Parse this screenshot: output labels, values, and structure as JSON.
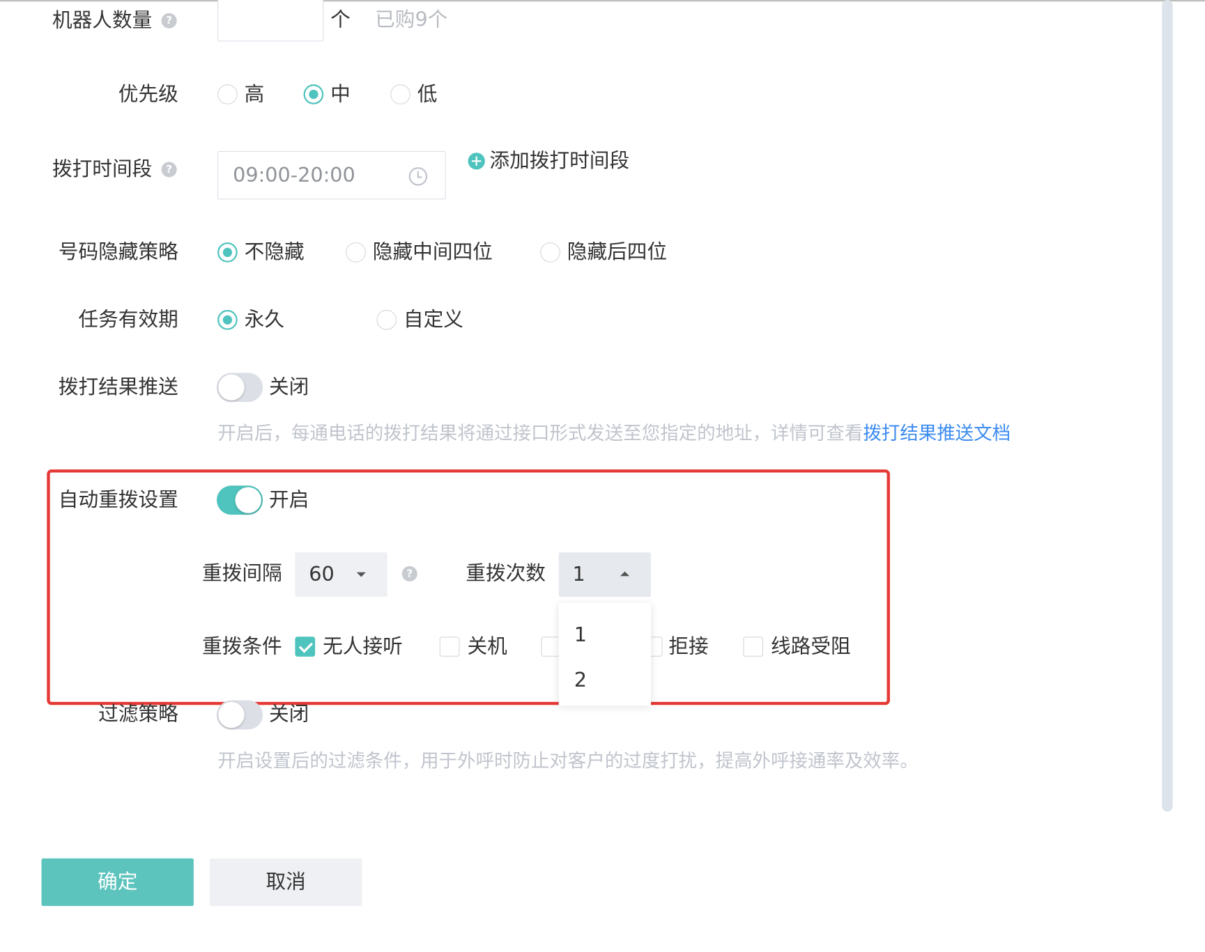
{
  "form": {
    "robot_count": {
      "label": "机器人数量",
      "help": "?",
      "value": "",
      "unit": "个",
      "purchased_note": "已购9个"
    },
    "priority": {
      "label": "优先级",
      "options": [
        "高",
        "中",
        "低"
      ],
      "selected": "中"
    },
    "dial_time": {
      "label": "拨打时间段",
      "help": "?",
      "value": "09:00-20:00",
      "add_label": "添加拨打时间段"
    },
    "number_hide": {
      "label": "号码隐藏策略",
      "options": [
        "不隐藏",
        "隐藏中间四位",
        "隐藏后四位"
      ],
      "selected": "不隐藏"
    },
    "validity": {
      "label": "任务有效期",
      "options": [
        "永久",
        "自定义"
      ],
      "selected": "永久"
    },
    "result_push": {
      "label": "拨打结果推送",
      "state_label": "关闭",
      "enabled": false,
      "hint": "开启后，每通电话的拨打结果将通过接口形式发送至您指定的地址，详情可查看",
      "hint_link": "拨打结果推送文档"
    },
    "auto_redial": {
      "label": "自动重拨设置",
      "state_label": "开启",
      "enabled": true,
      "interval_label": "重拨间隔",
      "interval_value": "60",
      "interval_help": "?",
      "count_label": "重拨次数",
      "count_value": "1",
      "count_options": [
        "1",
        "2"
      ],
      "conditions_label": "重拨条件",
      "conditions": [
        {
          "label": "无人接听",
          "checked": true
        },
        {
          "label": "关机",
          "checked": false
        },
        {
          "label": "",
          "checked": false
        },
        {
          "label": "拒接",
          "checked": false
        },
        {
          "label": "线路受阻",
          "checked": false
        }
      ]
    },
    "filter": {
      "label": "过滤策略",
      "state_label": "关闭",
      "enabled": false,
      "hint": "开启设置后的过滤条件，用于外呼时防止对客户的过度打扰，提高外呼接通率及效率。"
    }
  },
  "footer": {
    "confirm_label": "确定",
    "cancel_label": "取消"
  },
  "colors": {
    "accent": "#4fc3bd",
    "link": "#3c8bf0",
    "highlight_border": "#e53935"
  }
}
